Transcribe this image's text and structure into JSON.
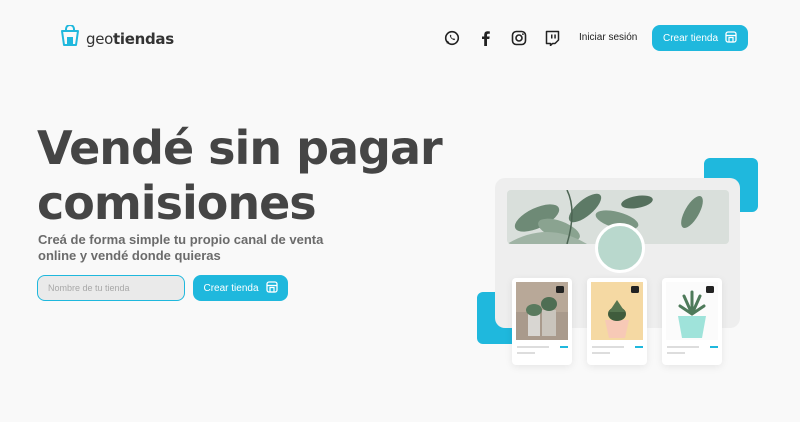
{
  "header": {
    "brand_light": "geo",
    "brand_bold": "tiendas",
    "social": [
      "whatsapp-icon",
      "facebook-icon",
      "instagram-icon",
      "twitch-icon"
    ],
    "login_label": "Iniciar sesión",
    "create_store_label": "Crear tienda"
  },
  "hero": {
    "title_line1": "Vendé sin pagar",
    "title_line2": "comisiones",
    "subtitle": "Creá de forma simple tu propio canal de venta online y vendé donde quieras",
    "input_placeholder": "Nombre de tu tienda",
    "create_store_label": "Crear tienda"
  },
  "colors": {
    "accent": "#1fb8dd",
    "title": "#454545",
    "background": "#f9f9f9"
  }
}
